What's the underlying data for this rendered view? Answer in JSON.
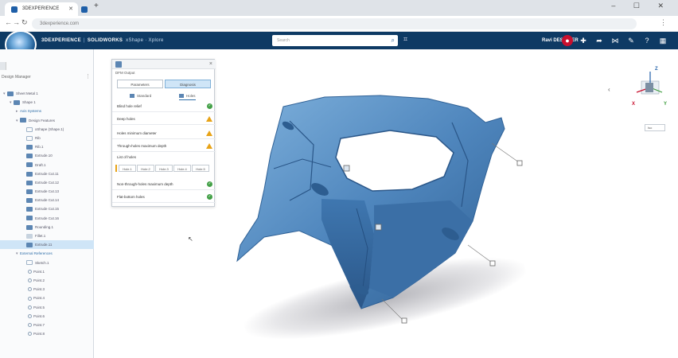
{
  "browser": {
    "tabs": [
      {
        "label": "3DEXPERIENCE",
        "active": true
      },
      {
        "label": "",
        "active": false
      }
    ],
    "new_tab": "+",
    "window_controls": "– ☐ ✕",
    "url": "3dexperience.com",
    "nav": {
      "back": "←",
      "forward": "→",
      "reload": "↻"
    }
  },
  "app_header": {
    "brand_3d": "3DEXPERIENCE",
    "brand_sw": "SOLIDWORKS",
    "app_name": "xShape · Xplore",
    "search_placeholder": "Search",
    "user": "Ravi  DESIGNER",
    "icons": [
      "compass-icon",
      "share-icon",
      "network-icon",
      "chat-icon",
      "help-icon",
      "apps-icon"
    ]
  },
  "left_panel": {
    "title": "Design Manager",
    "tree": [
      {
        "label": "Sheet Metal 1",
        "indent": 0,
        "icon": "part",
        "arrow": "▾"
      },
      {
        "label": "Shape 1",
        "indent": 1,
        "icon": "part",
        "arrow": "▾"
      },
      {
        "label": "Axis Systems",
        "indent": 2,
        "icon": "none",
        "arrow": "▸",
        "header": true
      },
      {
        "label": "Design Features",
        "indent": 2,
        "icon": "part",
        "arrow": "▾"
      },
      {
        "label": "xShape (Shape.1)",
        "indent": 3,
        "icon": "ghost",
        "arrow": ""
      },
      {
        "label": "Rib",
        "indent": 3,
        "icon": "ghost",
        "arrow": ""
      },
      {
        "label": "Rib.1",
        "indent": 3,
        "icon": "part",
        "arrow": ""
      },
      {
        "label": "Extrude.10",
        "indent": 3,
        "icon": "part",
        "arrow": ""
      },
      {
        "label": "Draft.1",
        "indent": 3,
        "icon": "part",
        "arrow": ""
      },
      {
        "label": "Extrude Cut.11",
        "indent": 3,
        "icon": "part",
        "arrow": ""
      },
      {
        "label": "Extrude Cut.12",
        "indent": 3,
        "icon": "part",
        "arrow": ""
      },
      {
        "label": "Extrude Cut.13",
        "indent": 3,
        "icon": "part",
        "arrow": ""
      },
      {
        "label": "Extrude Cut.14",
        "indent": 3,
        "icon": "part",
        "arrow": ""
      },
      {
        "label": "Extrude Cut.15",
        "indent": 3,
        "icon": "part",
        "arrow": ""
      },
      {
        "label": "Extrude Cut.16",
        "indent": 3,
        "icon": "part",
        "arrow": ""
      },
      {
        "label": "Rounding.1",
        "indent": 3,
        "icon": "part",
        "arrow": ""
      },
      {
        "label": "Fillet.1",
        "indent": 3,
        "icon": "light",
        "arrow": ""
      },
      {
        "label": "Extrude.11",
        "indent": 3,
        "icon": "part",
        "arrow": "",
        "selected": true
      },
      {
        "label": "External References",
        "indent": 2,
        "icon": "none",
        "arrow": "▾",
        "header": true
      },
      {
        "label": "Sketch.1",
        "indent": 3,
        "icon": "ghost",
        "arrow": ""
      },
      {
        "label": "Point.1",
        "indent": 3,
        "icon": "mini",
        "arrow": ""
      },
      {
        "label": "Point.2",
        "indent": 3,
        "icon": "mini",
        "arrow": ""
      },
      {
        "label": "Point.3",
        "indent": 3,
        "icon": "mini",
        "arrow": ""
      },
      {
        "label": "Point.4",
        "indent": 3,
        "icon": "mini",
        "arrow": ""
      },
      {
        "label": "Point.5",
        "indent": 3,
        "icon": "mini",
        "arrow": ""
      },
      {
        "label": "Point.6",
        "indent": 3,
        "icon": "mini",
        "arrow": ""
      },
      {
        "label": "Point.7",
        "indent": 3,
        "icon": "mini",
        "arrow": ""
      },
      {
        "label": "Point.8",
        "indent": 3,
        "icon": "mini",
        "arrow": ""
      }
    ]
  },
  "dfm_panel": {
    "title": "DFM Output",
    "segments": [
      "Parameters",
      "Diagnosis"
    ],
    "subtabs": [
      "Standard",
      "Holes"
    ],
    "checks": [
      {
        "label": "Blind hole relief",
        "status": "ok"
      },
      {
        "label": "Deep holes",
        "status": "warn"
      },
      {
        "label": "Holes minimum diameter",
        "status": "warn"
      },
      {
        "label": "Through-holes maximum depth",
        "status": "warn"
      },
      {
        "label": "Non-through-holes maximum depth",
        "status": "ok"
      },
      {
        "label": "Flat-bottom holes",
        "status": "ok"
      }
    ],
    "list_of_holes": "List of holes",
    "holes": [
      "Hole.1",
      "Hole.2",
      "Hole.3",
      "Hole.4",
      "Hole.5"
    ]
  },
  "viewport": {
    "orientation": {
      "x": "X",
      "y": "Y",
      "z": "Z"
    },
    "view_dropdown": "Iso",
    "collapse_icon": "‹"
  }
}
